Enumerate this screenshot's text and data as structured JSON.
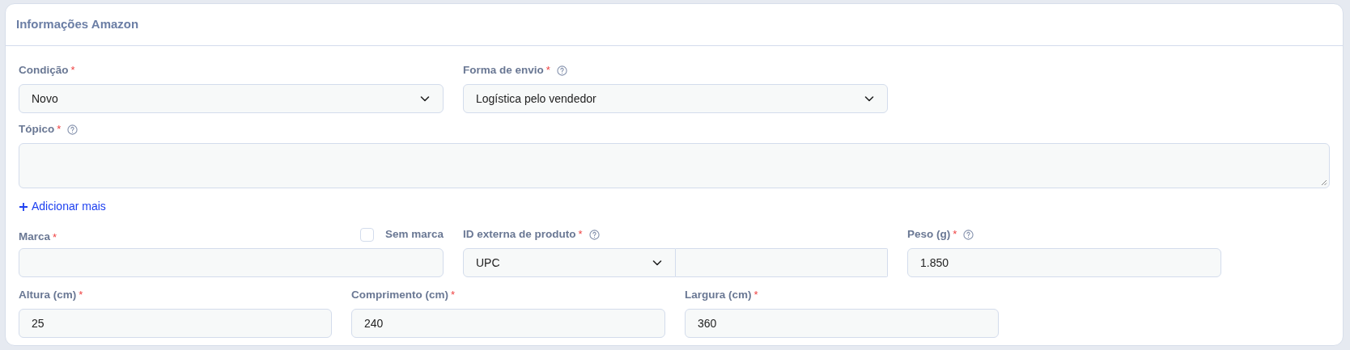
{
  "panel": {
    "title": "Informações Amazon"
  },
  "rows": [
    [
      {
        "kind": "select",
        "label": "Condição",
        "required_mark": "*",
        "help": false,
        "value": "Novo"
      },
      {
        "kind": "select",
        "label": "Forma de envio",
        "required_mark": "*",
        "help": true,
        "value": "Logística pelo vendedor"
      }
    ],
    [
      {
        "kind": "textarea",
        "label": "Tópico",
        "required_mark": "*",
        "help": true
      }
    ],
    [
      {
        "kind": "link",
        "label": "Adicionar mais"
      }
    ],
    [
      {
        "kind": "text",
        "label": "Marca",
        "required_mark": "*",
        "help": false,
        "checkbox": {
          "label": "Sem marca",
          "checked": false
        }
      },
      {
        "kind": "combo",
        "label": "ID externa de produto",
        "required_mark": "*",
        "help": true,
        "value": "UPC"
      },
      {
        "kind": "text",
        "label": "Peso (g)",
        "required_mark": "*",
        "help": true,
        "value": "1.850"
      }
    ],
    [
      {
        "kind": "text",
        "label": "Altura (cm)",
        "required_mark": "*",
        "help": false,
        "value": "25"
      },
      {
        "kind": "text",
        "label": "Comprimento (cm)",
        "required_mark": "*",
        "help": false,
        "value": "240"
      },
      {
        "kind": "text",
        "label": "Largura (cm)",
        "required_mark": "*",
        "help": false,
        "value": "360"
      }
    ]
  ]
}
